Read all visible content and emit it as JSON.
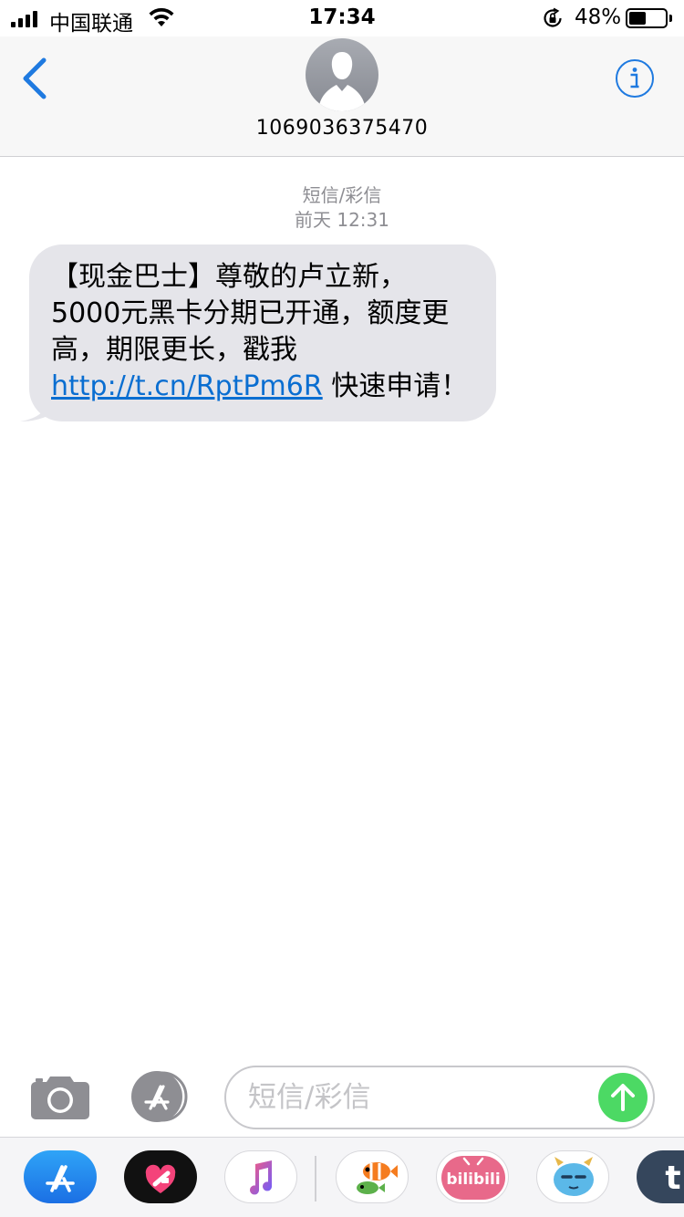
{
  "status_bar": {
    "carrier": "中国联通",
    "time": "17:34",
    "battery_percent": "48%",
    "battery_level": 0.48,
    "signal_bars": 4
  },
  "nav": {
    "contact_name": "1069036375470"
  },
  "conversation": {
    "message_type": "短信/彩信",
    "timestamp": "前天 12:31",
    "messages": [
      {
        "direction": "incoming",
        "text_before": "【现金巴士】尊敬的卢立新，5000元黑卡分期已开通，额度更高，期限更长，戳我 ",
        "link": "http://t.cn/RptPm6R",
        "text_after": " 快速申请！"
      }
    ]
  },
  "input_bar": {
    "placeholder": "短信/彩信",
    "value": ""
  },
  "app_drawer": {
    "apps": [
      "app-store-icon",
      "digital-touch-icon",
      "music-icon",
      "clownfish-sticker-icon",
      "bilibili-icon",
      "blue-monster-sticker-icon",
      "tumblr-icon"
    ]
  },
  "colors": {
    "ios_blue": "#0a6ed1",
    "bubble_gray": "#e5e5ea",
    "send_green": "#4cd964",
    "meta_gray": "#8e8e93"
  }
}
